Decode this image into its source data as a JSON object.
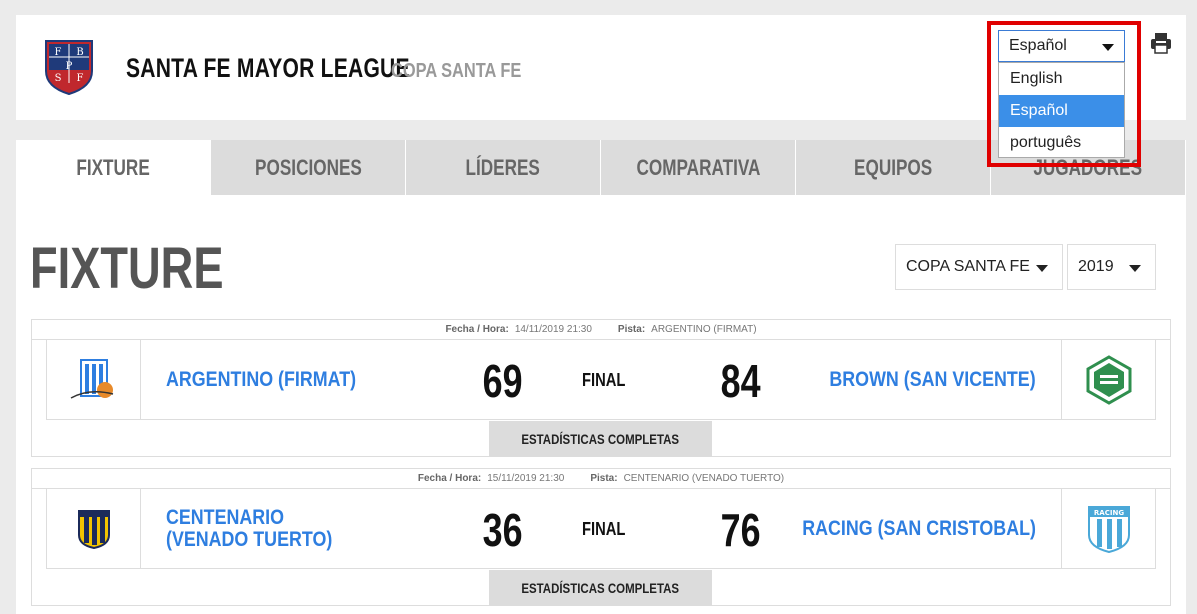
{
  "header": {
    "league_name": "SANTA FE MAYOR LEAGUE",
    "cup_name": "COPA SANTA FE",
    "logo_letters": [
      "F",
      "B",
      "P",
      "S",
      "F"
    ]
  },
  "language": {
    "selected": "Español",
    "options": [
      {
        "label": "English",
        "selected": false
      },
      {
        "label": "Español",
        "selected": true
      },
      {
        "label": "português",
        "selected": false
      }
    ]
  },
  "tabs": [
    {
      "label": "FIXTURE",
      "active": true
    },
    {
      "label": "POSICIONES",
      "active": false
    },
    {
      "label": "LÍDERES",
      "active": false
    },
    {
      "label": "COMPARATIVA",
      "active": false
    },
    {
      "label": "EQUIPOS",
      "active": false
    },
    {
      "label": "JUGADORES",
      "active": false
    }
  ],
  "page_title": "FIXTURE",
  "filters": {
    "competition": "COPA SANTA FE",
    "year": "2019"
  },
  "matches": [
    {
      "date_label": "Fecha / Hora:",
      "date": "14/11/2019 21:30",
      "venue_label": "Pista:",
      "venue": "ARGENTINO (FIRMAT)",
      "home_team": "ARGENTINO (FIRMAT)",
      "home_score": "69",
      "status": "FINAL",
      "away_score": "84",
      "away_team": "BROWN (SAN VICENTE)",
      "stats_label": "ESTADÍSTICAS COMPLETAS"
    },
    {
      "date_label": "Fecha / Hora:",
      "date": "15/11/2019 21:30",
      "venue_label": "Pista:",
      "venue": "CENTENARIO (VENADO TUERTO)",
      "home_team": "CENTENARIO (VENADO TUERTO)",
      "home_score": "36",
      "status": "FINAL",
      "away_score": "76",
      "away_team": "RACING (SAN CRISTOBAL)",
      "stats_label": "ESTADÍSTICAS COMPLETAS",
      "away_logo_text": "RACING"
    }
  ],
  "colors": {
    "accent_blue": "#2e7ee0",
    "highlight_red": "#e00000",
    "tab_inactive": "#dcdcdc"
  }
}
